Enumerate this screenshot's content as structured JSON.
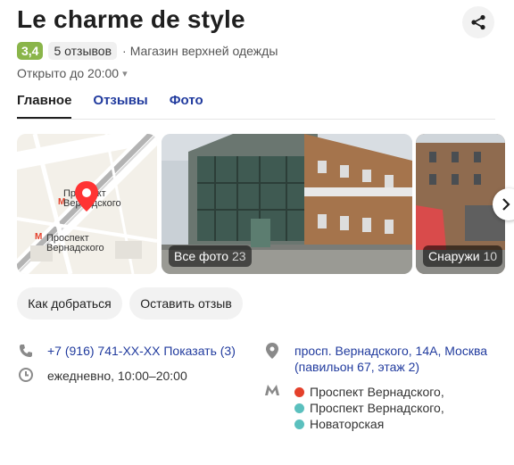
{
  "header": {
    "title": "Le charme de style",
    "rating": "3,4",
    "reviews": "5 отзывов",
    "separator": "·",
    "category": "Магазин верхней одежды",
    "hours": "Открыто до 20:00",
    "hours_caret": "▾"
  },
  "tabs": [
    {
      "label": "Главное",
      "active": true
    },
    {
      "label": "Отзывы",
      "active": false
    },
    {
      "label": "Фото",
      "active": false
    }
  ],
  "gallery": {
    "map_labels": [
      "Проспект Вернадского",
      "Проспект Вернадского"
    ],
    "all_photos_label": "Все фото",
    "all_photos_count": "23",
    "outside_label": "Снаружи",
    "outside_count": "10"
  },
  "actions": {
    "route": "Как добраться",
    "review": "Оставить отзыв"
  },
  "contacts": {
    "phone": "+7 (916) 741-XX-XX",
    "show_phone": "Показать (3)",
    "schedule": "ежедневно, 10:00–20:00",
    "address_line1": "просп. Вернадского, 14А, Москва",
    "address_line2": "(павильон 67, этаж 2)",
    "metro": [
      {
        "name": "Проспект Вернадского,",
        "color": "#e4402b"
      },
      {
        "name": "Проспект Вернадского,",
        "color": "#5bc0be"
      },
      {
        "name": "Новаторская",
        "color": "#5bc0be"
      }
    ]
  },
  "colors": {
    "accent": "#213b9e",
    "rating_bg": "#8ab54a",
    "pin": "#f33"
  }
}
